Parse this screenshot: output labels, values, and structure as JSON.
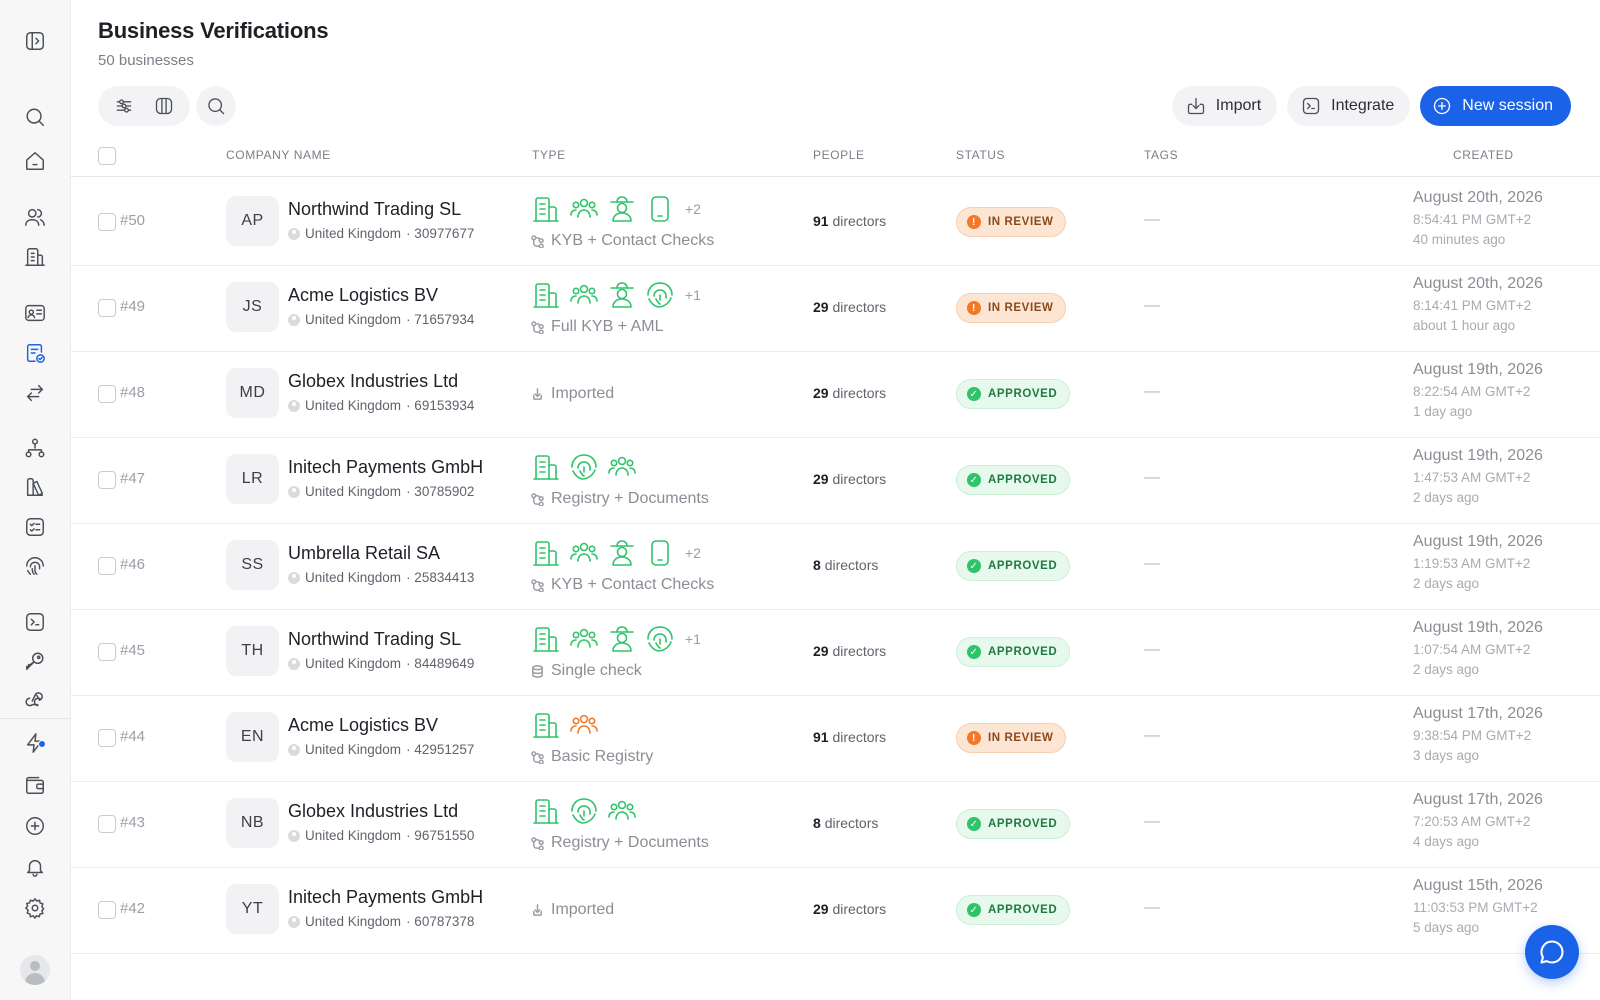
{
  "header": {
    "title": "Business Verifications",
    "subtitle": "50 businesses"
  },
  "actions": {
    "import_label": "Import",
    "integrate_label": "Integrate",
    "new_session_label": "New session"
  },
  "columns": {
    "company": "COMPANY NAME",
    "type": "TYPE",
    "people": "PEOPLE",
    "status": "STATUS",
    "tags": "TAGS",
    "created": "CREATED"
  },
  "colors": {
    "primary": "#1a62e8",
    "check_green": "#2fc36a",
    "review_orange": "#f07a28"
  },
  "sidebar": {
    "icons": [
      "sidebar-toggle-icon",
      "search-icon",
      "home-icon",
      "users-icon",
      "building-icon",
      "id-card-icon",
      "verification-icon",
      "transfer-icon",
      "workflow-icon",
      "library-icon",
      "checklist-icon",
      "fingerprint-icon",
      "terminal-icon",
      "key-icon",
      "webhook-icon",
      "bolt-icon",
      "wallet-icon",
      "add-circle-icon",
      "bell-icon",
      "gear-icon"
    ]
  },
  "rows": [
    {
      "num": "#50",
      "initials": "AP",
      "name": "Northwind Trading SL",
      "country": "United Kingdom",
      "reg": "· 30977677",
      "icons": [
        "building",
        "people",
        "person-badge",
        "phone"
      ],
      "more": "+2",
      "type_label": "KYB + Contact Checks",
      "type_icon": "flow",
      "people_count": "91",
      "people_unit": "directors",
      "status": "IN REVIEW",
      "status_kind": "review",
      "tags": "—",
      "date": "August 20th, 2026",
      "time": "8:54:41 PM GMT+2",
      "ago": "40 minutes ago"
    },
    {
      "num": "#49",
      "initials": "JS",
      "name": "Acme Logistics BV",
      "country": "United Kingdom",
      "reg": "· 71657934",
      "icons": [
        "building",
        "people",
        "person-badge",
        "fingerprint"
      ],
      "more": "+1",
      "type_label": "Full KYB + AML",
      "type_icon": "flow",
      "people_count": "29",
      "people_unit": "directors",
      "status": "IN REVIEW",
      "status_kind": "review",
      "tags": "—",
      "date": "August 20th, 2026",
      "time": "8:14:41 PM GMT+2",
      "ago": "about 1 hour ago"
    },
    {
      "num": "#48",
      "initials": "MD",
      "name": "Globex Industries Ltd",
      "country": "United Kingdom",
      "reg": "· 69153934",
      "icons": [],
      "more": "",
      "type_label": "Imported",
      "type_icon": "import",
      "people_count": "29",
      "people_unit": "directors",
      "status": "APPROVED",
      "status_kind": "approved",
      "tags": "—",
      "date": "August 19th, 2026",
      "time": "8:22:54 AM GMT+2",
      "ago": "1 day ago"
    },
    {
      "num": "#47",
      "initials": "LR",
      "name": "Initech Payments GmbH",
      "country": "United Kingdom",
      "reg": "· 30785902",
      "icons": [
        "building",
        "fingerprint",
        "people"
      ],
      "more": "",
      "type_label": "Registry + Documents",
      "type_icon": "flow",
      "people_count": "29",
      "people_unit": "directors",
      "status": "APPROVED",
      "status_kind": "approved",
      "tags": "—",
      "date": "August 19th, 2026",
      "time": "1:47:53 AM GMT+2",
      "ago": "2 days ago"
    },
    {
      "num": "#46",
      "initials": "SS",
      "name": "Umbrella Retail SA",
      "country": "United Kingdom",
      "reg": "· 25834413",
      "icons": [
        "building",
        "people",
        "person-badge",
        "phone"
      ],
      "more": "+2",
      "type_label": "KYB + Contact Checks",
      "type_icon": "flow",
      "people_count": "8",
      "people_unit": "directors",
      "status": "APPROVED",
      "status_kind": "approved",
      "tags": "—",
      "date": "August 19th, 2026",
      "time": "1:19:53 AM GMT+2",
      "ago": "2 days ago"
    },
    {
      "num": "#45",
      "initials": "TH",
      "name": "Northwind Trading SL",
      "country": "United Kingdom",
      "reg": "· 84489649",
      "icons": [
        "building",
        "people",
        "person-badge",
        "fingerprint"
      ],
      "more": "+1",
      "type_label": "Single check",
      "type_icon": "database",
      "people_count": "29",
      "people_unit": "directors",
      "status": "APPROVED",
      "status_kind": "approved",
      "tags": "—",
      "date": "August 19th, 2026",
      "time": "1:07:54 AM GMT+2",
      "ago": "2 days ago"
    },
    {
      "num": "#44",
      "initials": "EN",
      "name": "Acme Logistics BV",
      "country": "United Kingdom",
      "reg": "· 42951257",
      "icons": [
        "building",
        "people-orange"
      ],
      "more": "",
      "type_label": "Basic Registry",
      "type_icon": "flow",
      "people_count": "91",
      "people_unit": "directors",
      "status": "IN REVIEW",
      "status_kind": "review",
      "tags": "—",
      "date": "August 17th, 2026",
      "time": "9:38:54 PM GMT+2",
      "ago": "3 days ago"
    },
    {
      "num": "#43",
      "initials": "NB",
      "name": "Globex Industries Ltd",
      "country": "United Kingdom",
      "reg": "· 96751550",
      "icons": [
        "building",
        "fingerprint",
        "people"
      ],
      "more": "",
      "type_label": "Registry + Documents",
      "type_icon": "flow",
      "people_count": "8",
      "people_unit": "directors",
      "status": "APPROVED",
      "status_kind": "approved",
      "tags": "—",
      "date": "August 17th, 2026",
      "time": "7:20:53 AM GMT+2",
      "ago": "4 days ago"
    },
    {
      "num": "#42",
      "initials": "YT",
      "name": "Initech Payments GmbH",
      "country": "United Kingdom",
      "reg": "· 60787378",
      "icons": [],
      "more": "",
      "type_label": "Imported",
      "type_icon": "import",
      "people_count": "29",
      "people_unit": "directors",
      "status": "APPROVED",
      "status_kind": "approved",
      "tags": "—",
      "date": "August 15th, 2026",
      "time": "11:03:53 PM GMT+2",
      "ago": "5 days ago"
    }
  ]
}
